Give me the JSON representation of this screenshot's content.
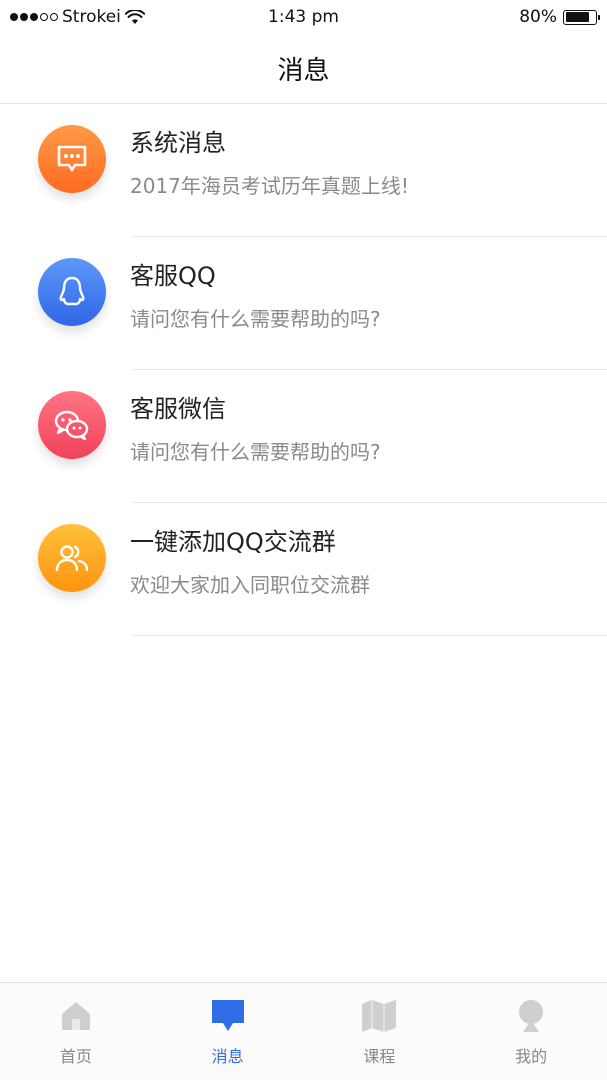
{
  "status_bar": {
    "carrier": "Strokei",
    "time": "1:43 pm",
    "battery": "80%",
    "battery_level": 0.8
  },
  "header": {
    "title": "消息"
  },
  "messages": [
    {
      "title": "系统消息",
      "subtitle": "2017年海员考试历年真题上线!",
      "icon": "chat-bubble-icon",
      "color": "#ff7d2a"
    },
    {
      "title": "客服QQ",
      "subtitle": "请问您有什么需要帮助的吗?",
      "icon": "qq-penguin-icon",
      "color": "#3f7cf0"
    },
    {
      "title": "客服微信",
      "subtitle": "请问您有什么需要帮助的吗?",
      "icon": "wechat-icon",
      "color": "#f5566a"
    },
    {
      "title": " 一键添加QQ交流群",
      "subtitle": "欢迎大家加入同职位交流群",
      "icon": "group-users-icon",
      "color": "#ffa820"
    }
  ],
  "tabs": [
    {
      "label": "首页",
      "icon": "home-icon",
      "active": false
    },
    {
      "label": "消息",
      "icon": "message-icon",
      "active": true
    },
    {
      "label": "课程",
      "icon": "map-book-icon",
      "active": false
    },
    {
      "label": "我的",
      "icon": "profile-icon",
      "active": false
    }
  ],
  "colors": {
    "accent": "#2f6de6",
    "inactive_tab": "#cfcfcf"
  }
}
